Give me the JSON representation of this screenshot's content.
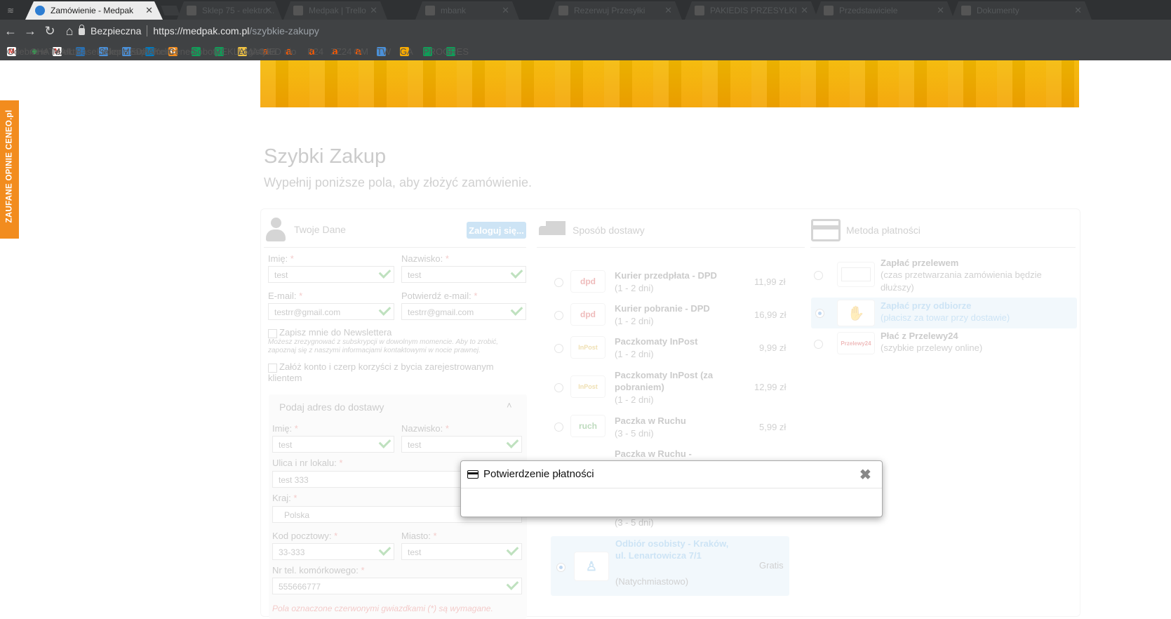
{
  "browser": {
    "active_tab": "Zamówienie - Medpak",
    "dim_tabs": [
      "Sklep 75 - elektro...",
      "Medpak | Trello",
      "mbank",
      "Rezerwuj Przesyłki",
      "PAKIEDIS PRZESYŁKI",
      "Przedstawiciele",
      "Dokumenty"
    ],
    "secure_label": "Bezpieczna",
    "url_host": "https://medpak.com.pl",
    "url_path": "/szybkie-zakupy"
  },
  "bookmarks": [
    {
      "label": "Odebrane - elektrop",
      "icon": "gmail-icon",
      "color": "#d93025"
    },
    {
      "label": "CHAT",
      "icon": "dot-icon",
      "color": "#34a853"
    },
    {
      "label": "MAIL",
      "icon": "gmail-icon",
      "color": "#d93025"
    },
    {
      "label": "BaseLinker - zarządz",
      "icon": "baselinker-icon",
      "color": "#2a6fb0"
    },
    {
      "label": "Sklep z suplementan",
      "icon": "shop-icon",
      "color": "#4a90d9"
    },
    {
      "label": "MEDPAK",
      "icon": "medpak-icon",
      "color": "#4a90d9"
    },
    {
      "label": "* Trello",
      "icon": "trello-icon",
      "color": "#0079bf"
    },
    {
      "label": "Ceneo",
      "icon": "ceneo-icon",
      "color": "#f28c1e"
    },
    {
      "label": "Soboty",
      "icon": "sheet-icon",
      "color": "#0f9d58"
    },
    {
      "label": "REKLAMACJE",
      "icon": "sheet-icon",
      "color": "#0f9d58"
    },
    {
      "label": "Logistyka",
      "icon": "folder-icon",
      "color": "#f4c542"
    },
    {
      "label": "MED",
      "icon": "allegro-icon",
      "color": "#ff5a00"
    },
    {
      "label": "riio",
      "icon": "allegro-icon",
      "color": "#ff5a00"
    },
    {
      "label": "P24",
      "icon": "allegro-icon",
      "color": "#ff5a00"
    },
    {
      "label": "ZZ24",
      "icon": "allegro-icon",
      "color": "#ff5a00"
    },
    {
      "label": "GM",
      "icon": "allegro-icon",
      "color": "#ff5a00"
    },
    {
      "label": "TW",
      "icon": "chart-icon",
      "color": "#4a90d9"
    },
    {
      "label": "GA",
      "icon": "analytics-icon",
      "color": "#f9ab00"
    },
    {
      "label": "PROGRES",
      "icon": "sheet-icon",
      "color": "#0f9d58"
    },
    {
      "label": "S",
      "icon": "sheet-icon",
      "color": "#0f9d58"
    }
  ],
  "ceneo_badge": "ZAUFANE OPINIE CENEO.pl",
  "page": {
    "title": "Szybki Zakup",
    "subtitle": "Wypełnij poniższe pola, aby złożyć zamówienie."
  },
  "customer": {
    "header": "Twoje Dane",
    "login_button": "Zaloguj się...",
    "first_name_label": "Imię:",
    "first_name": "test",
    "last_name_label": "Nazwisko:",
    "last_name": "test",
    "email_label": "E-mail:",
    "email": "testrr@gmail.com",
    "email_confirm_label": "Potwierdź e-mail:",
    "email_confirm": "testrr@gmail.com",
    "newsletter_label": "Zapisz mnie do Newslettera",
    "newsletter_note": "Możesz zrezygnować z subskrypcji w dowolnym momencie. Aby to zrobić, zapoznaj się z naszymi informacjami kontaktowymi w nocie prawnej.",
    "account_label": "Załóż konto i czerp korzyści z bycia zarejestrowanym klientem",
    "required_mark": "*"
  },
  "address": {
    "header": "Podaj adres do dostawy",
    "first_name_label": "Imię:",
    "first_name": "test",
    "last_name_label": "Nazwisko:",
    "last_name": "test",
    "street_label": "Ulica i nr lokalu:",
    "street": "test 333",
    "country_label": "Kraj:",
    "country": "Polska",
    "postcode_label": "Kod pocztowy:",
    "postcode": "33-333",
    "city_label": "Miasto:",
    "city": "test",
    "phone_label": "Nr tel. komórkowego:",
    "phone": "555666777",
    "required_note": "Pola oznaczone czerwonymi gwiazdkami (*) są wymagane."
  },
  "shipping": {
    "header": "Sposób dostawy",
    "options": [
      {
        "name": "Kurier przedpłata - DPD",
        "time": "(1 - 2 dni)",
        "price": "11,99 zł",
        "logo": "dpd"
      },
      {
        "name": "Kurier pobranie - DPD",
        "time": "(1 - 2 dni)",
        "price": "16,99 zł",
        "logo": "dpd"
      },
      {
        "name": "Paczkomaty InPost",
        "time": "(1 - 2 dni)",
        "price": "9,99 zł",
        "logo": "InPost"
      },
      {
        "name": "Paczkomaty InPost (za pobraniem)",
        "time": "(1 - 2 dni)",
        "price": "12,99 zł",
        "logo": "InPost"
      },
      {
        "name": "Paczka w Ruchu",
        "time": "(3 - 5 dni)",
        "price": "5,99 zł",
        "logo": "ruch"
      },
      {
        "name": "Paczka w Ruchu -",
        "time": "(3 - 5 dni)",
        "price": "",
        "logo": "ruch"
      }
    ],
    "pickup": {
      "name": "Odbiór osobisty - Kraków, ul. Lenartowicza 7/1",
      "time": "(Natychmiastowo)",
      "price": "Gratis"
    }
  },
  "payment": {
    "header": "Metoda płatności",
    "options": [
      {
        "name": "Zapłać przelewem",
        "desc": "(czas przetwarzania zamówienia będzie dłuższy)",
        "selected": false
      },
      {
        "name": "Zapłać przy odbiorze",
        "desc": "(płacisz za towar przy dostawie)",
        "selected": true
      },
      {
        "name": "Płać z Przelewy24",
        "desc": "(szybkie przelewy online)",
        "selected": false
      }
    ],
    "p24_logo": "Przelewy24"
  },
  "modal": {
    "title": "Potwierdzenie płatności",
    "close": "✖"
  }
}
